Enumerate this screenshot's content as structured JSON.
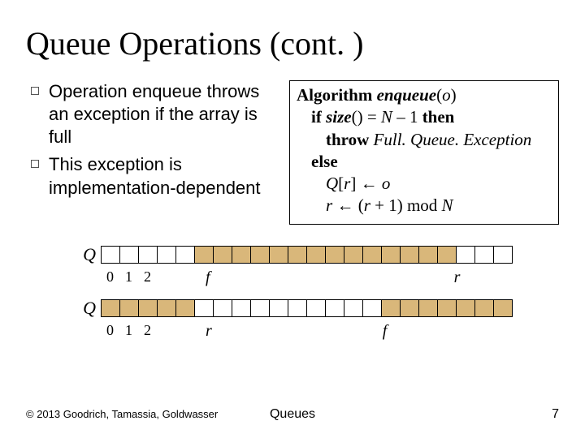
{
  "title": "Queue Operations (cont. )",
  "bullets": [
    "Operation enqueue throws an exception if the array is full",
    "This exception is implementation-dependent"
  ],
  "algorithm": {
    "head_kw": "Algorithm",
    "head_fn": "enqueue",
    "head_arg": "o",
    "l1_if": "if",
    "l1_size": "size",
    "l1_eq": "() =",
    "l1_N": "N",
    "l1_minus": " – 1 ",
    "l1_then": "then",
    "l2_throw": "throw",
    "l2_exc": "Full. Queue. Exception",
    "l3_else": "else",
    "l4_Q": "Q",
    "l4_br_open": "[",
    "l4_r": "r",
    "l4_br_close": "] ← ",
    "l4_o": "o",
    "l5_r1": "r",
    "l5_arrow": " ← (",
    "l5_r2": "r",
    "l5_plus": " + 1) mod ",
    "l5_N": "N"
  },
  "diagrams": {
    "q_label": "Q",
    "ticks": [
      "0",
      "1",
      "2"
    ],
    "row1": {
      "pattern": [
        0,
        0,
        0,
        0,
        0,
        1,
        1,
        1,
        1,
        1,
        1,
        1,
        1,
        1,
        1,
        1,
        1,
        1,
        1,
        0,
        0,
        0
      ],
      "left_label": "f",
      "right_label": "r"
    },
    "row2": {
      "pattern": [
        1,
        1,
        1,
        1,
        1,
        0,
        0,
        0,
        0,
        0,
        0,
        0,
        0,
        0,
        0,
        1,
        1,
        1,
        1,
        1,
        1,
        1
      ],
      "left_label": "r",
      "right_label": "f"
    }
  },
  "footer": {
    "copyright": "© 2013 Goodrich, Tamassia, Goldwasser",
    "center": "Queues",
    "page": "7"
  }
}
